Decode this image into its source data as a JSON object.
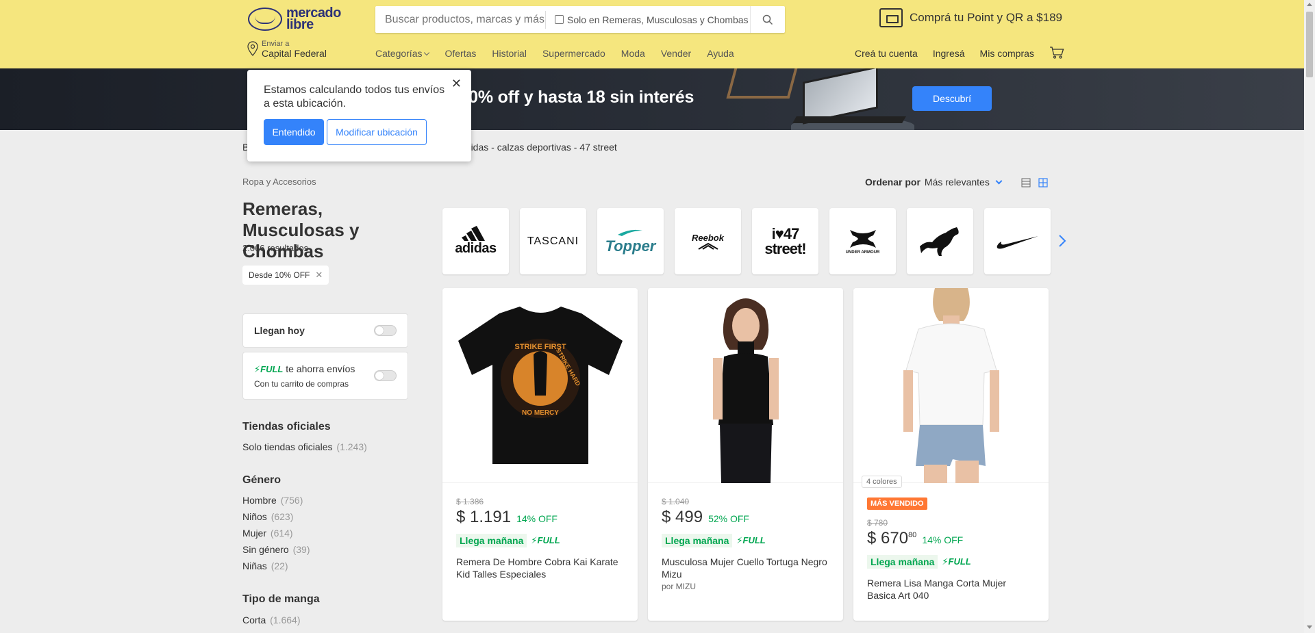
{
  "header": {
    "logo_line1": "mercado",
    "logo_line2": "libre",
    "search_placeholder": "Buscar productos, marcas y más…",
    "search_scope_label": "Solo en Remeras, Musculosas y Chombas",
    "promo_text": "Comprá tu Point y QR a $189",
    "location_small": "Enviar a",
    "location_big": "Capital Federal",
    "nav": [
      "Categorías",
      "Ofertas",
      "Historial",
      "Supermercado",
      "Moda",
      "Vender",
      "Ayuda"
    ],
    "user_nav": [
      "Creá tu cuenta",
      "Ingresá",
      "Mis compras"
    ]
  },
  "banner": {
    "text": "a 40% off y hasta 18 sin interés",
    "button": "Descubrí"
  },
  "popup": {
    "text": "Estamos calculando todos tus envíos a esta ubicación.",
    "primary": "Entendido",
    "secondary": "Modificar ubicación",
    "close": "✕"
  },
  "breadcrumb": {
    "first": "B",
    "rest": "adidas  -  calzas deportivas  -  47 street"
  },
  "left": {
    "category": "Ropa y Accesorios",
    "title": "Remeras, Musculosas y Chombas",
    "results": "2.066 resultados",
    "chip": "Desde 10% OFF",
    "filter_llegan": "Llegan hoy",
    "full_label": "FULL",
    "full_text": "te ahorra envíos",
    "full_sub": "Con tu carrito de compras",
    "tiendas_title": "Tiendas oficiales",
    "tiendas_item": "Solo tiendas oficiales",
    "tiendas_count": "(1.243)",
    "genero_title": "Género",
    "genero": [
      {
        "label": "Hombre",
        "count": "(756)"
      },
      {
        "label": "Niños",
        "count": "(623)"
      },
      {
        "label": "Mujer",
        "count": "(614)"
      },
      {
        "label": "Sin género",
        "count": "(39)"
      },
      {
        "label": "Niñas",
        "count": "(22)"
      }
    ],
    "manga_title": "Tipo de manga",
    "manga_item": "Corta",
    "manga_count": "(1.664)"
  },
  "sort": {
    "label": "Ordenar por",
    "value": "Más relevantes"
  },
  "brands": [
    "adidas",
    "TASCANI",
    "Topper",
    "Reebok",
    "i♥47 street!",
    "UNDER ARMOUR",
    "PUMA",
    "NIKE"
  ],
  "products": [
    {
      "old_price": "$ 1.386",
      "price": "$ 1.191",
      "price_cents": "",
      "discount": "14% OFF",
      "shipping": "Llega mañana",
      "full": "FULL",
      "title": "Remera De Hombre Cobra Kai Karate Kid Talles Especiales",
      "seller": "",
      "badge": "",
      "colors": "",
      "image_text_1": "STRIKE FIRST",
      "image_text_2": "STRIKE HARD",
      "image_text_3": "NO MERCY"
    },
    {
      "old_price": "$ 1.040",
      "price": "$ 499",
      "price_cents": "",
      "discount": "52% OFF",
      "shipping": "Llega mañana",
      "full": "FULL",
      "title": "Musculosa Mujer Cuello Tortuga Negro Mizu",
      "seller": "por MIZU",
      "badge": "",
      "colors": ""
    },
    {
      "old_price": "$ 780",
      "price": "$ 670",
      "price_cents": "80",
      "discount": "14% OFF",
      "shipping": "Llega mañana",
      "full": "FULL",
      "title": "Remera Lisa Manga Corta Mujer Basica Art 040",
      "seller": "",
      "badge": "MÁS VENDIDO",
      "colors": "4 colores"
    }
  ],
  "colors": {
    "header_bg": "#f5e67e",
    "accent": "#3483fa",
    "green": "#00a650",
    "best_seller": "#ff7733"
  }
}
